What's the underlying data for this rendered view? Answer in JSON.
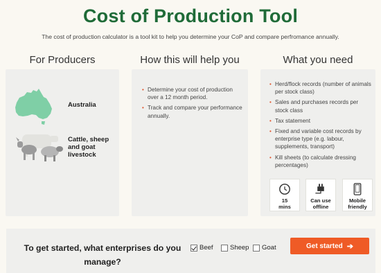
{
  "header": {
    "title": "Cost of Production Tool",
    "subtitle": "The cost of production calculator is a tool kit to help you determine your CoP and compare perfromance annually."
  },
  "producers": {
    "heading": "For Producers",
    "region_label": "Australia",
    "livestock_label_lines": [
      "Cattle, sheep",
      "and goat",
      "livestock"
    ]
  },
  "help": {
    "heading": "How this will help you",
    "items": [
      "Determine your cost of production over a 12 month period.",
      "Track and compare your performance annually."
    ]
  },
  "needs": {
    "heading": "What you need",
    "items": [
      "Herd/flock records (number of animals per stock class)",
      "Sales and purchases records per stock class",
      "Tax statement",
      "Fixed and variable cost records by enterprise type (e.g. labour, supplements, transport)",
      "Kill sheets (to calculate dressing percentages)"
    ],
    "features": [
      {
        "icon": "clock-icon",
        "lines": [
          "15",
          "mins"
        ]
      },
      {
        "icon": "plug-icon",
        "lines": [
          "Can use",
          "offline"
        ]
      },
      {
        "icon": "mobile-icon",
        "lines": [
          "Mobile",
          "friendly"
        ]
      }
    ]
  },
  "getstarted": {
    "question_lines": [
      "To get started, what enterprises do you",
      "manage?"
    ],
    "options": [
      {
        "label": "Beef",
        "checked": true
      },
      {
        "label": "Sheep",
        "checked": false
      },
      {
        "label": "Goat",
        "checked": false
      }
    ],
    "button_label": "Get started",
    "button_arrow": "➔"
  },
  "colors": {
    "title_green": "#1f6b38",
    "accent_orange": "#ef5b26",
    "map_green": "#7fcfa6",
    "panel_bg": "#efefed"
  }
}
